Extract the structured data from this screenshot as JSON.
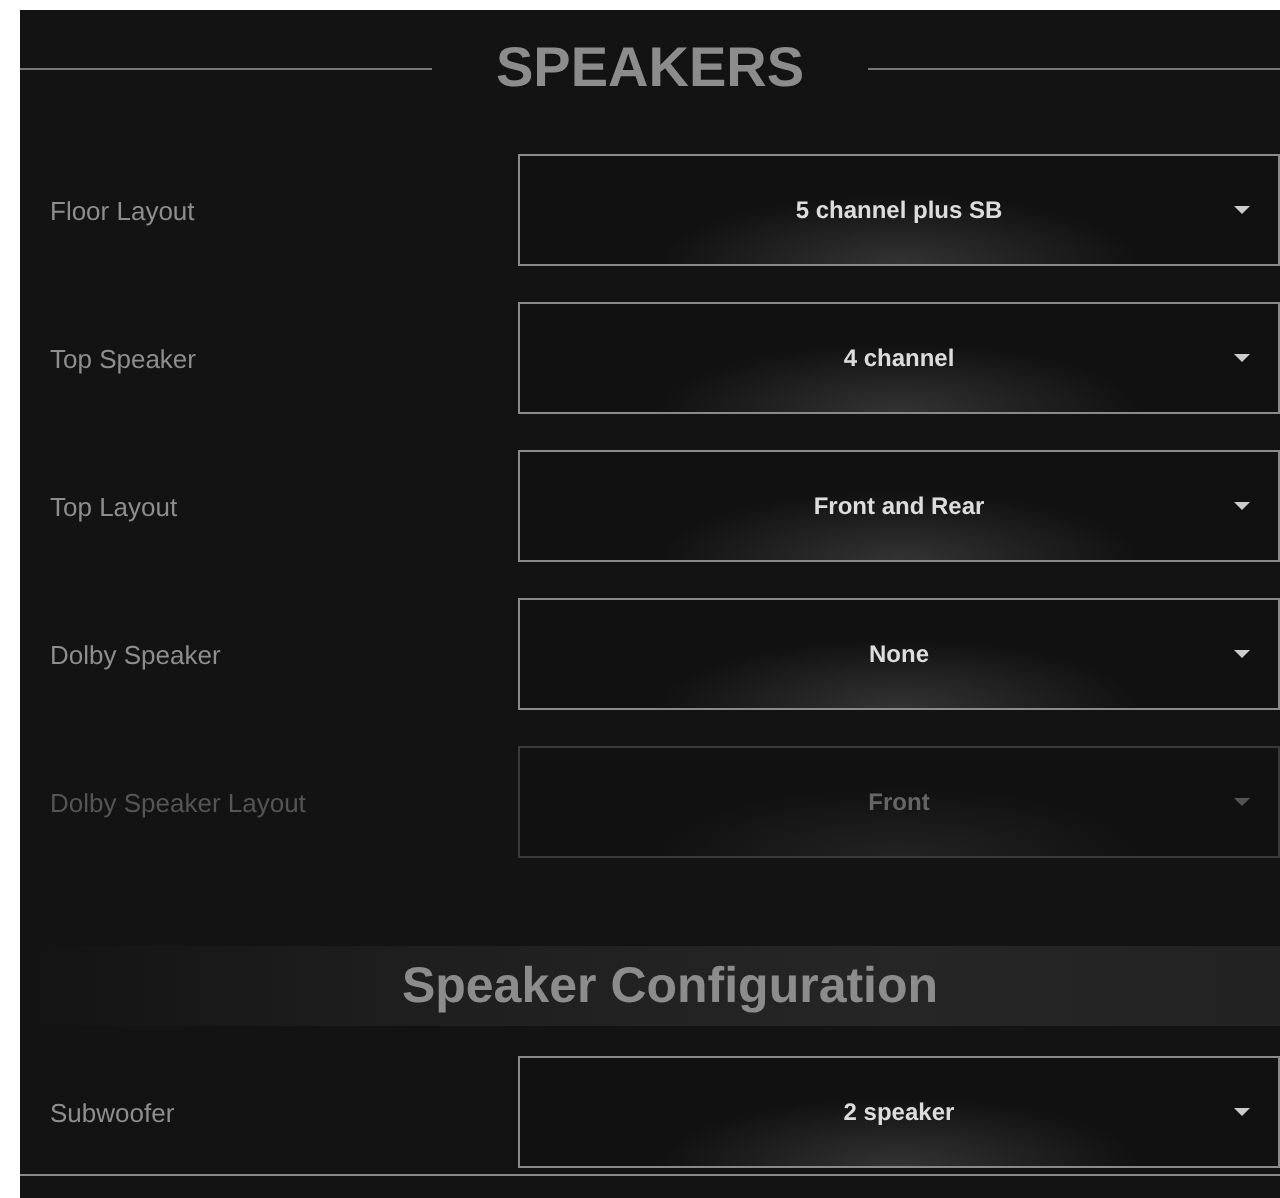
{
  "title": "SPEAKERS",
  "settings": [
    {
      "label": "Floor Layout",
      "value": "5 channel plus SB",
      "disabled": false
    },
    {
      "label": "Top Speaker",
      "value": "4 channel",
      "disabled": false
    },
    {
      "label": "Top Layout",
      "value": "Front and Rear",
      "disabled": false
    },
    {
      "label": "Dolby Speaker",
      "value": "None",
      "disabled": false
    },
    {
      "label": "Dolby Speaker Layout",
      "value": "Front",
      "disabled": true
    }
  ],
  "section": {
    "title": "Speaker Configuration",
    "settings": [
      {
        "label": "Subwoofer",
        "value": "2 speaker",
        "disabled": false
      }
    ]
  }
}
